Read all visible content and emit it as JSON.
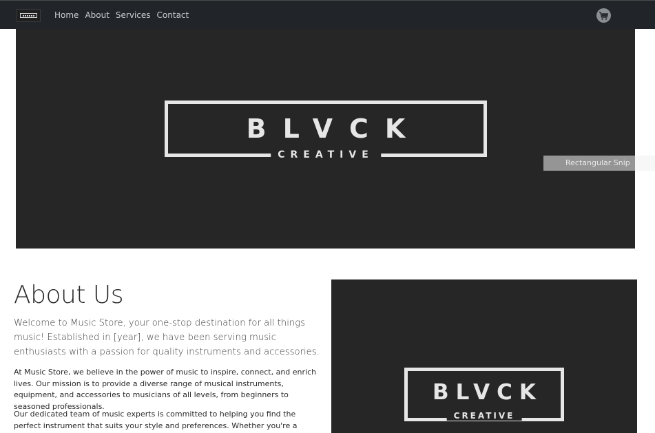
{
  "nav": {
    "logo_text": "BLVCK",
    "links": [
      "Home",
      "About",
      "Services",
      "Contact"
    ],
    "cart_icon": "cart-icon"
  },
  "hero": {
    "logo_word": "BLVCK",
    "logo_sub": "CREATIVE",
    "background": "#262626"
  },
  "overlay": {
    "label": "Rectangular Snip"
  },
  "about": {
    "title": "About Us",
    "lead": "Welcome to Music Store, your one-stop destination for all things music! Established in [year], we have been serving music enthusiasts with a passion for quality instruments and accessories.",
    "p1": "At Music Store, we believe in the power of music to inspire, connect, and enrich lives. Our mission is to provide a diverse range of musical instruments, equipment, and accessories to musicians of all levels, from beginners to seasoned professionals.",
    "p2": "Our dedicated team of music experts is committed to helping you find the perfect instrument that suits your style and preferences. Whether you're a guitarist, pianist,",
    "image_logo_word": "BLVCK",
    "image_logo_sub": "CREATIVE"
  },
  "colors": {
    "navbar": "#212529",
    "logo": "#e6e6e6"
  }
}
